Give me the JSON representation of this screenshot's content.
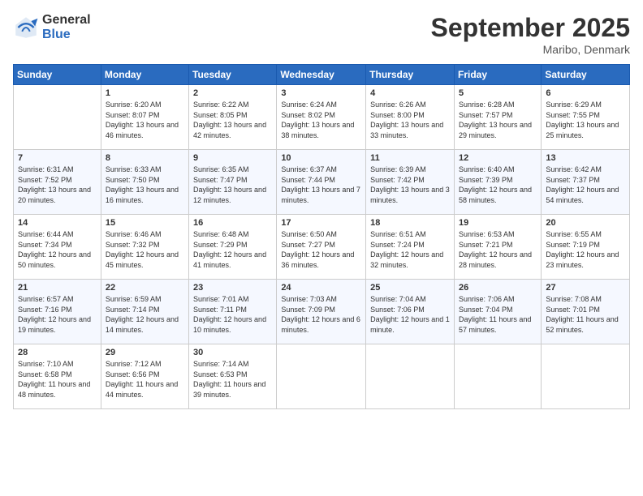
{
  "logo": {
    "general": "General",
    "blue": "Blue"
  },
  "title": "September 2025",
  "location": "Maribo, Denmark",
  "days_of_week": [
    "Sunday",
    "Monday",
    "Tuesday",
    "Wednesday",
    "Thursday",
    "Friday",
    "Saturday"
  ],
  "weeks": [
    [
      {
        "day": "",
        "sunrise": "",
        "sunset": "",
        "daylight": ""
      },
      {
        "day": "1",
        "sunrise": "Sunrise: 6:20 AM",
        "sunset": "Sunset: 8:07 PM",
        "daylight": "Daylight: 13 hours and 46 minutes."
      },
      {
        "day": "2",
        "sunrise": "Sunrise: 6:22 AM",
        "sunset": "Sunset: 8:05 PM",
        "daylight": "Daylight: 13 hours and 42 minutes."
      },
      {
        "day": "3",
        "sunrise": "Sunrise: 6:24 AM",
        "sunset": "Sunset: 8:02 PM",
        "daylight": "Daylight: 13 hours and 38 minutes."
      },
      {
        "day": "4",
        "sunrise": "Sunrise: 6:26 AM",
        "sunset": "Sunset: 8:00 PM",
        "daylight": "Daylight: 13 hours and 33 minutes."
      },
      {
        "day": "5",
        "sunrise": "Sunrise: 6:28 AM",
        "sunset": "Sunset: 7:57 PM",
        "daylight": "Daylight: 13 hours and 29 minutes."
      },
      {
        "day": "6",
        "sunrise": "Sunrise: 6:29 AM",
        "sunset": "Sunset: 7:55 PM",
        "daylight": "Daylight: 13 hours and 25 minutes."
      }
    ],
    [
      {
        "day": "7",
        "sunrise": "Sunrise: 6:31 AM",
        "sunset": "Sunset: 7:52 PM",
        "daylight": "Daylight: 13 hours and 20 minutes."
      },
      {
        "day": "8",
        "sunrise": "Sunrise: 6:33 AM",
        "sunset": "Sunset: 7:50 PM",
        "daylight": "Daylight: 13 hours and 16 minutes."
      },
      {
        "day": "9",
        "sunrise": "Sunrise: 6:35 AM",
        "sunset": "Sunset: 7:47 PM",
        "daylight": "Daylight: 13 hours and 12 minutes."
      },
      {
        "day": "10",
        "sunrise": "Sunrise: 6:37 AM",
        "sunset": "Sunset: 7:44 PM",
        "daylight": "Daylight: 13 hours and 7 minutes."
      },
      {
        "day": "11",
        "sunrise": "Sunrise: 6:39 AM",
        "sunset": "Sunset: 7:42 PM",
        "daylight": "Daylight: 13 hours and 3 minutes."
      },
      {
        "day": "12",
        "sunrise": "Sunrise: 6:40 AM",
        "sunset": "Sunset: 7:39 PM",
        "daylight": "Daylight: 12 hours and 58 minutes."
      },
      {
        "day": "13",
        "sunrise": "Sunrise: 6:42 AM",
        "sunset": "Sunset: 7:37 PM",
        "daylight": "Daylight: 12 hours and 54 minutes."
      }
    ],
    [
      {
        "day": "14",
        "sunrise": "Sunrise: 6:44 AM",
        "sunset": "Sunset: 7:34 PM",
        "daylight": "Daylight: 12 hours and 50 minutes."
      },
      {
        "day": "15",
        "sunrise": "Sunrise: 6:46 AM",
        "sunset": "Sunset: 7:32 PM",
        "daylight": "Daylight: 12 hours and 45 minutes."
      },
      {
        "day": "16",
        "sunrise": "Sunrise: 6:48 AM",
        "sunset": "Sunset: 7:29 PM",
        "daylight": "Daylight: 12 hours and 41 minutes."
      },
      {
        "day": "17",
        "sunrise": "Sunrise: 6:50 AM",
        "sunset": "Sunset: 7:27 PM",
        "daylight": "Daylight: 12 hours and 36 minutes."
      },
      {
        "day": "18",
        "sunrise": "Sunrise: 6:51 AM",
        "sunset": "Sunset: 7:24 PM",
        "daylight": "Daylight: 12 hours and 32 minutes."
      },
      {
        "day": "19",
        "sunrise": "Sunrise: 6:53 AM",
        "sunset": "Sunset: 7:21 PM",
        "daylight": "Daylight: 12 hours and 28 minutes."
      },
      {
        "day": "20",
        "sunrise": "Sunrise: 6:55 AM",
        "sunset": "Sunset: 7:19 PM",
        "daylight": "Daylight: 12 hours and 23 minutes."
      }
    ],
    [
      {
        "day": "21",
        "sunrise": "Sunrise: 6:57 AM",
        "sunset": "Sunset: 7:16 PM",
        "daylight": "Daylight: 12 hours and 19 minutes."
      },
      {
        "day": "22",
        "sunrise": "Sunrise: 6:59 AM",
        "sunset": "Sunset: 7:14 PM",
        "daylight": "Daylight: 12 hours and 14 minutes."
      },
      {
        "day": "23",
        "sunrise": "Sunrise: 7:01 AM",
        "sunset": "Sunset: 7:11 PM",
        "daylight": "Daylight: 12 hours and 10 minutes."
      },
      {
        "day": "24",
        "sunrise": "Sunrise: 7:03 AM",
        "sunset": "Sunset: 7:09 PM",
        "daylight": "Daylight: 12 hours and 6 minutes."
      },
      {
        "day": "25",
        "sunrise": "Sunrise: 7:04 AM",
        "sunset": "Sunset: 7:06 PM",
        "daylight": "Daylight: 12 hours and 1 minute."
      },
      {
        "day": "26",
        "sunrise": "Sunrise: 7:06 AM",
        "sunset": "Sunset: 7:04 PM",
        "daylight": "Daylight: 11 hours and 57 minutes."
      },
      {
        "day": "27",
        "sunrise": "Sunrise: 7:08 AM",
        "sunset": "Sunset: 7:01 PM",
        "daylight": "Daylight: 11 hours and 52 minutes."
      }
    ],
    [
      {
        "day": "28",
        "sunrise": "Sunrise: 7:10 AM",
        "sunset": "Sunset: 6:58 PM",
        "daylight": "Daylight: 11 hours and 48 minutes."
      },
      {
        "day": "29",
        "sunrise": "Sunrise: 7:12 AM",
        "sunset": "Sunset: 6:56 PM",
        "daylight": "Daylight: 11 hours and 44 minutes."
      },
      {
        "day": "30",
        "sunrise": "Sunrise: 7:14 AM",
        "sunset": "Sunset: 6:53 PM",
        "daylight": "Daylight: 11 hours and 39 minutes."
      },
      {
        "day": "",
        "sunrise": "",
        "sunset": "",
        "daylight": ""
      },
      {
        "day": "",
        "sunrise": "",
        "sunset": "",
        "daylight": ""
      },
      {
        "day": "",
        "sunrise": "",
        "sunset": "",
        "daylight": ""
      },
      {
        "day": "",
        "sunrise": "",
        "sunset": "",
        "daylight": ""
      }
    ]
  ]
}
